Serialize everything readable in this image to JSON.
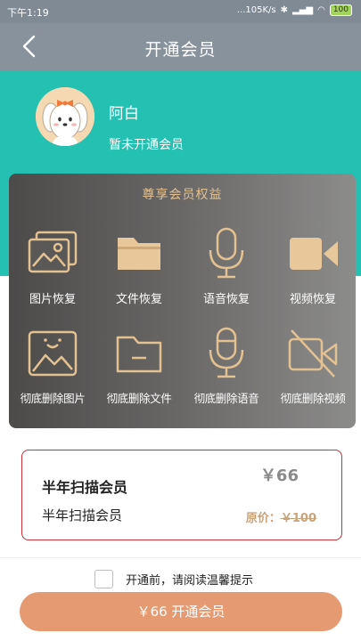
{
  "status_bar": {
    "time": "下午1:19",
    "network": "...105K/s",
    "battery": "100"
  },
  "nav": {
    "title": "开通会员"
  },
  "user": {
    "name": "阿白",
    "status": "暂未开通会员"
  },
  "benefits": {
    "title": "尊享会员权益",
    "items": [
      {
        "label": "图片恢复",
        "icon": "image-icon"
      },
      {
        "label": "文件恢复",
        "icon": "folder-icon"
      },
      {
        "label": "语音恢复",
        "icon": "microphone-icon"
      },
      {
        "label": "视频恢复",
        "icon": "video-camera-icon"
      },
      {
        "label": "彻底删除图片",
        "icon": "image-delete-icon"
      },
      {
        "label": "彻底删除文件",
        "icon": "folder-delete-icon"
      },
      {
        "label": "彻底删除语音",
        "icon": "microphone-delete-icon"
      },
      {
        "label": "彻底删除视频",
        "icon": "video-off-icon"
      }
    ]
  },
  "plan": {
    "title": "半年扫描会员",
    "subtitle": "半年扫描会员",
    "price": "￥66",
    "original_label": "原价：",
    "original_price": "￥100"
  },
  "agreement": {
    "text": "开通前，请阅读温馨提示",
    "checked": false
  },
  "pay_button": {
    "label": "￥66 开通会员"
  },
  "colors": {
    "teal": "#24c0b2",
    "gold": "#e3c190",
    "accent": "#e69a72",
    "border_red": "#c9303a"
  }
}
